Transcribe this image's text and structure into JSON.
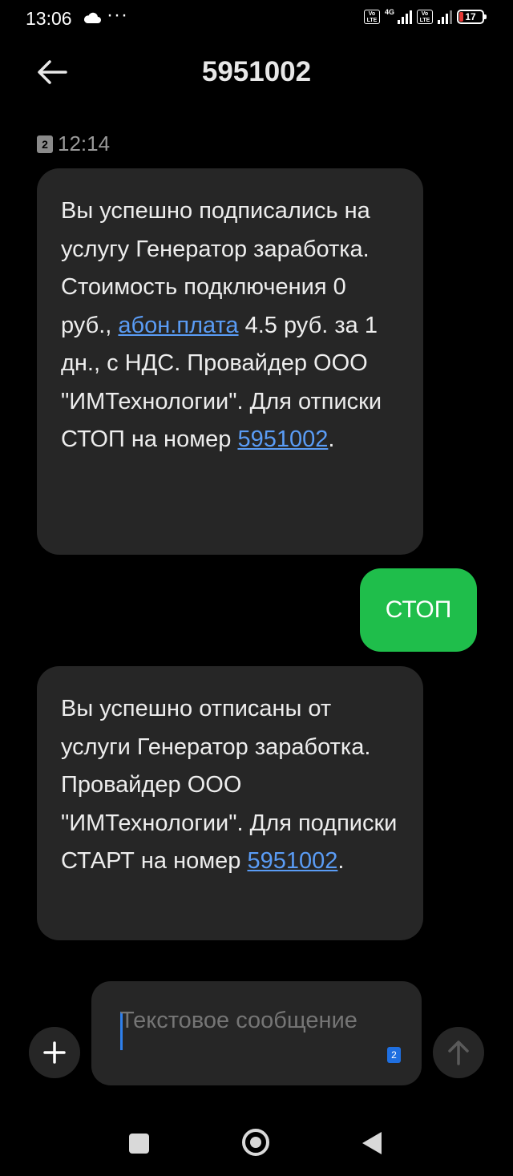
{
  "status_bar": {
    "time": "13:06",
    "more_indicator": "···",
    "volte_label": "Vo LTE",
    "network_type": "4G",
    "battery_level": "17"
  },
  "header": {
    "title": "5951002",
    "back_icon": "arrow-left-icon"
  },
  "messages": {
    "first": {
      "sim_slot": "2",
      "time": "12:14",
      "text_part1": "Вы успешно подписались на услугу Генератор заработка. Стоимость подключения 0 руб., ",
      "link_fee": "абон.плата",
      "text_part2": " 4.5 руб. за 1 дн., с НДС. Провайдер ООО \"ИМТехнологии\". Для отписки СТОП на номер ",
      "link_number": "5951002",
      "text_end": "."
    },
    "outgoing": {
      "text": "СТОП"
    },
    "second": {
      "text_part1": "Вы успешно отписаны от услуги Генератор заработка. Провайдер ООО \"ИМТехнологии\". Для подписки СТАРТ на номер ",
      "link_number": "5951002",
      "text_end": "."
    }
  },
  "composer": {
    "placeholder": "Текстовое сообщение",
    "sim_badge": "2",
    "attach_icon": "plus-icon",
    "send_icon": "arrow-up-icon"
  },
  "colors": {
    "background": "#000000",
    "incoming_bubble": "#262626",
    "outgoing_bubble": "#1fbe4b",
    "link": "#5a9cf5",
    "accent": "#1f6fe0"
  }
}
